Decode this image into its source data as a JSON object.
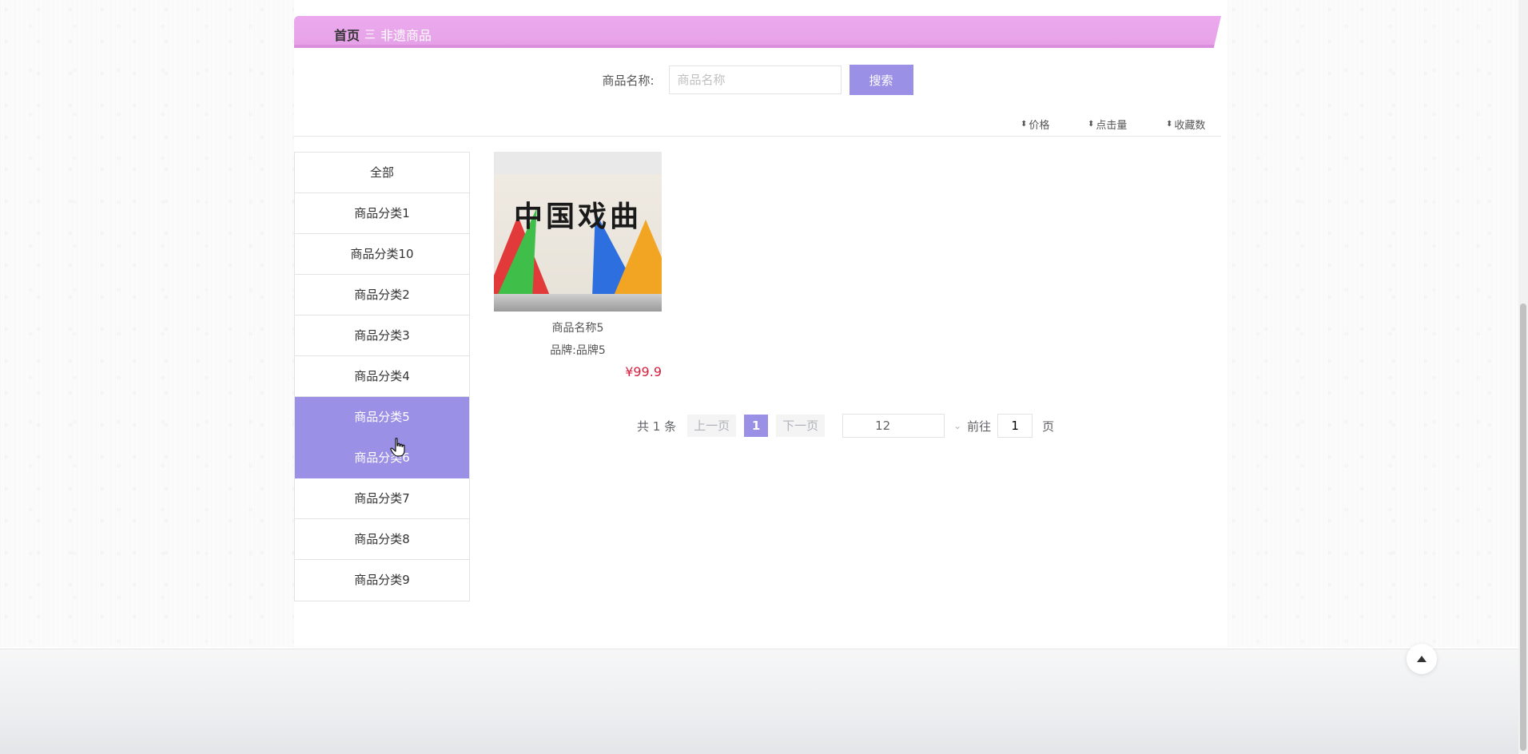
{
  "breadcrumb": {
    "home": "首页",
    "separator": "三",
    "current": "非遗商品"
  },
  "search": {
    "label": "商品名称:",
    "placeholder": "商品名称",
    "value": "",
    "button_label": "搜索"
  },
  "sort": {
    "icon": "sort-updown-icon",
    "items": [
      "价格",
      "点击量",
      "收藏数"
    ]
  },
  "categories": {
    "items": [
      "全部",
      "商品分类1",
      "商品分类10",
      "商品分类2",
      "商品分类3",
      "商品分类4",
      "商品分类5",
      "商品分类6",
      "商品分类7",
      "商品分类8",
      "商品分类9"
    ],
    "active": [
      "商品分类5",
      "商品分类6"
    ]
  },
  "product": {
    "image_text": "中国戏曲",
    "name": "商品名称5",
    "brand": "品牌:品牌5",
    "price": "¥99.9"
  },
  "pagination": {
    "total": "共 1 条",
    "prev": "上一页",
    "current_page": "1",
    "next": "下一页",
    "page_size": "12",
    "goto_label": "前往",
    "goto_value": "1",
    "page_suffix": "页"
  },
  "colors": {
    "accent": "#9a90e6",
    "banner": "#eca8ee",
    "price": "#d81e3c"
  }
}
